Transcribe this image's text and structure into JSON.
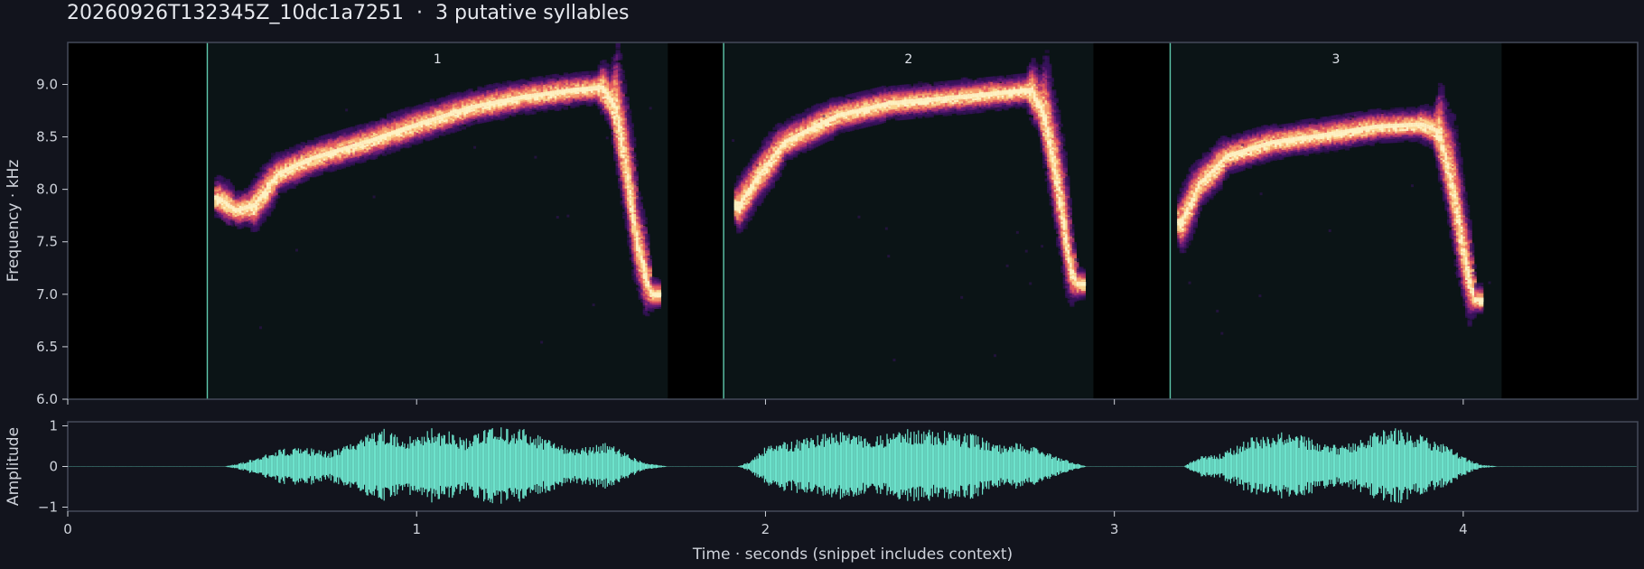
{
  "title": "20260926T132345Z_10dc1a7251  ·  3 putative syllables",
  "colors": {
    "background": "#12141d",
    "axes_frame": "#444a5a",
    "spec_background": "#000000",
    "syllable_region": "#0b1416",
    "boundary": "#5fc9ad",
    "waveform": "#6de3cc",
    "heat_low": "#3a1260",
    "heat_mid": "#b3366f",
    "heat_high": "#fdf2c4"
  },
  "chart_data": [
    {
      "type": "heatmap",
      "name": "spectrogram",
      "ylabel": "Frequency · kHz",
      "ylim": [
        6.0,
        9.4
      ],
      "xlim": [
        0,
        4.5
      ],
      "yticks": [
        "6.0",
        "6.5",
        "7.0",
        "7.5",
        "8.0",
        "8.5",
        "9.0"
      ],
      "ytick_values": [
        6.0,
        6.5,
        7.0,
        7.5,
        8.0,
        8.5,
        9.0
      ],
      "xtick_values": [
        0,
        1,
        2,
        3,
        4
      ],
      "syllables": [
        {
          "label": "1",
          "start": 0.4,
          "end": 1.72,
          "contour": [
            [
              0.43,
              7.92
            ],
            [
              0.48,
              7.8
            ],
            [
              0.53,
              7.85
            ],
            [
              0.6,
              8.15
            ],
            [
              0.7,
              8.3
            ],
            [
              0.85,
              8.45
            ],
            [
              1.0,
              8.62
            ],
            [
              1.15,
              8.78
            ],
            [
              1.3,
              8.88
            ],
            [
              1.45,
              8.95
            ],
            [
              1.53,
              8.97
            ],
            [
              1.57,
              8.78
            ],
            [
              1.6,
              8.2
            ],
            [
              1.63,
              7.5
            ],
            [
              1.67,
              7.0
            ]
          ]
        },
        {
          "label": "2",
          "start": 1.88,
          "end": 2.94,
          "contour": [
            [
              1.92,
              7.85
            ],
            [
              1.97,
              8.1
            ],
            [
              2.05,
              8.45
            ],
            [
              2.2,
              8.7
            ],
            [
              2.35,
              8.82
            ],
            [
              2.55,
              8.88
            ],
            [
              2.7,
              8.93
            ],
            [
              2.76,
              8.95
            ],
            [
              2.8,
              8.7
            ],
            [
              2.84,
              8.0
            ],
            [
              2.87,
              7.3
            ],
            [
              2.89,
              7.1
            ]
          ]
        },
        {
          "label": "3",
          "start": 3.16,
          "end": 4.11,
          "contour": [
            [
              3.19,
              7.7
            ],
            [
              3.24,
              8.05
            ],
            [
              3.32,
              8.32
            ],
            [
              3.45,
              8.45
            ],
            [
              3.6,
              8.52
            ],
            [
              3.75,
              8.6
            ],
            [
              3.88,
              8.62
            ],
            [
              3.93,
              8.55
            ],
            [
              3.97,
              8.0
            ],
            [
              4.0,
              7.4
            ],
            [
              4.03,
              6.95
            ]
          ]
        }
      ]
    },
    {
      "type": "area",
      "name": "waveform",
      "ylabel": "Amplitude",
      "xlabel": "Time · seconds (snippet includes context)",
      "ylim": [
        -1.1,
        1.1
      ],
      "xlim": [
        0,
        4.5
      ],
      "yticks": [
        "1",
        "0",
        "−1"
      ],
      "ytick_values": [
        1,
        0,
        -1
      ],
      "xticks": [
        "0",
        "1",
        "2",
        "3",
        "4"
      ],
      "xtick_values": [
        0,
        1,
        2,
        3,
        4
      ],
      "envelope": [
        [
          0.0,
          0.0
        ],
        [
          0.45,
          0.0
        ],
        [
          0.5,
          0.1
        ],
        [
          0.55,
          0.25
        ],
        [
          0.62,
          0.45
        ],
        [
          0.7,
          0.45
        ],
        [
          0.75,
          0.35
        ],
        [
          0.8,
          0.6
        ],
        [
          0.85,
          0.75
        ],
        [
          0.9,
          0.95
        ],
        [
          0.97,
          0.7
        ],
        [
          1.03,
          1.0
        ],
        [
          1.1,
          0.85
        ],
        [
          1.15,
          0.7
        ],
        [
          1.2,
          0.95
        ],
        [
          1.28,
          1.0
        ],
        [
          1.35,
          0.8
        ],
        [
          1.4,
          0.6
        ],
        [
          1.47,
          0.45
        ],
        [
          1.55,
          0.6
        ],
        [
          1.6,
          0.35
        ],
        [
          1.65,
          0.1
        ],
        [
          1.72,
          0.0
        ],
        [
          1.92,
          0.0
        ],
        [
          1.96,
          0.15
        ],
        [
          2.0,
          0.5
        ],
        [
          2.1,
          0.7
        ],
        [
          2.2,
          0.9
        ],
        [
          2.32,
          0.75
        ],
        [
          2.42,
          0.95
        ],
        [
          2.5,
          0.9
        ],
        [
          2.6,
          0.8
        ],
        [
          2.66,
          0.55
        ],
        [
          2.72,
          0.6
        ],
        [
          2.78,
          0.45
        ],
        [
          2.85,
          0.2
        ],
        [
          2.92,
          0.0
        ],
        [
          3.2,
          0.0
        ],
        [
          3.24,
          0.25
        ],
        [
          3.3,
          0.3
        ],
        [
          3.4,
          0.75
        ],
        [
          3.5,
          0.9
        ],
        [
          3.58,
          0.65
        ],
        [
          3.65,
          0.5
        ],
        [
          3.72,
          0.75
        ],
        [
          3.8,
          1.0
        ],
        [
          3.88,
          0.8
        ],
        [
          3.95,
          0.55
        ],
        [
          4.0,
          0.25
        ],
        [
          4.05,
          0.05
        ],
        [
          4.1,
          0.0
        ],
        [
          4.5,
          0.0
        ]
      ]
    }
  ]
}
